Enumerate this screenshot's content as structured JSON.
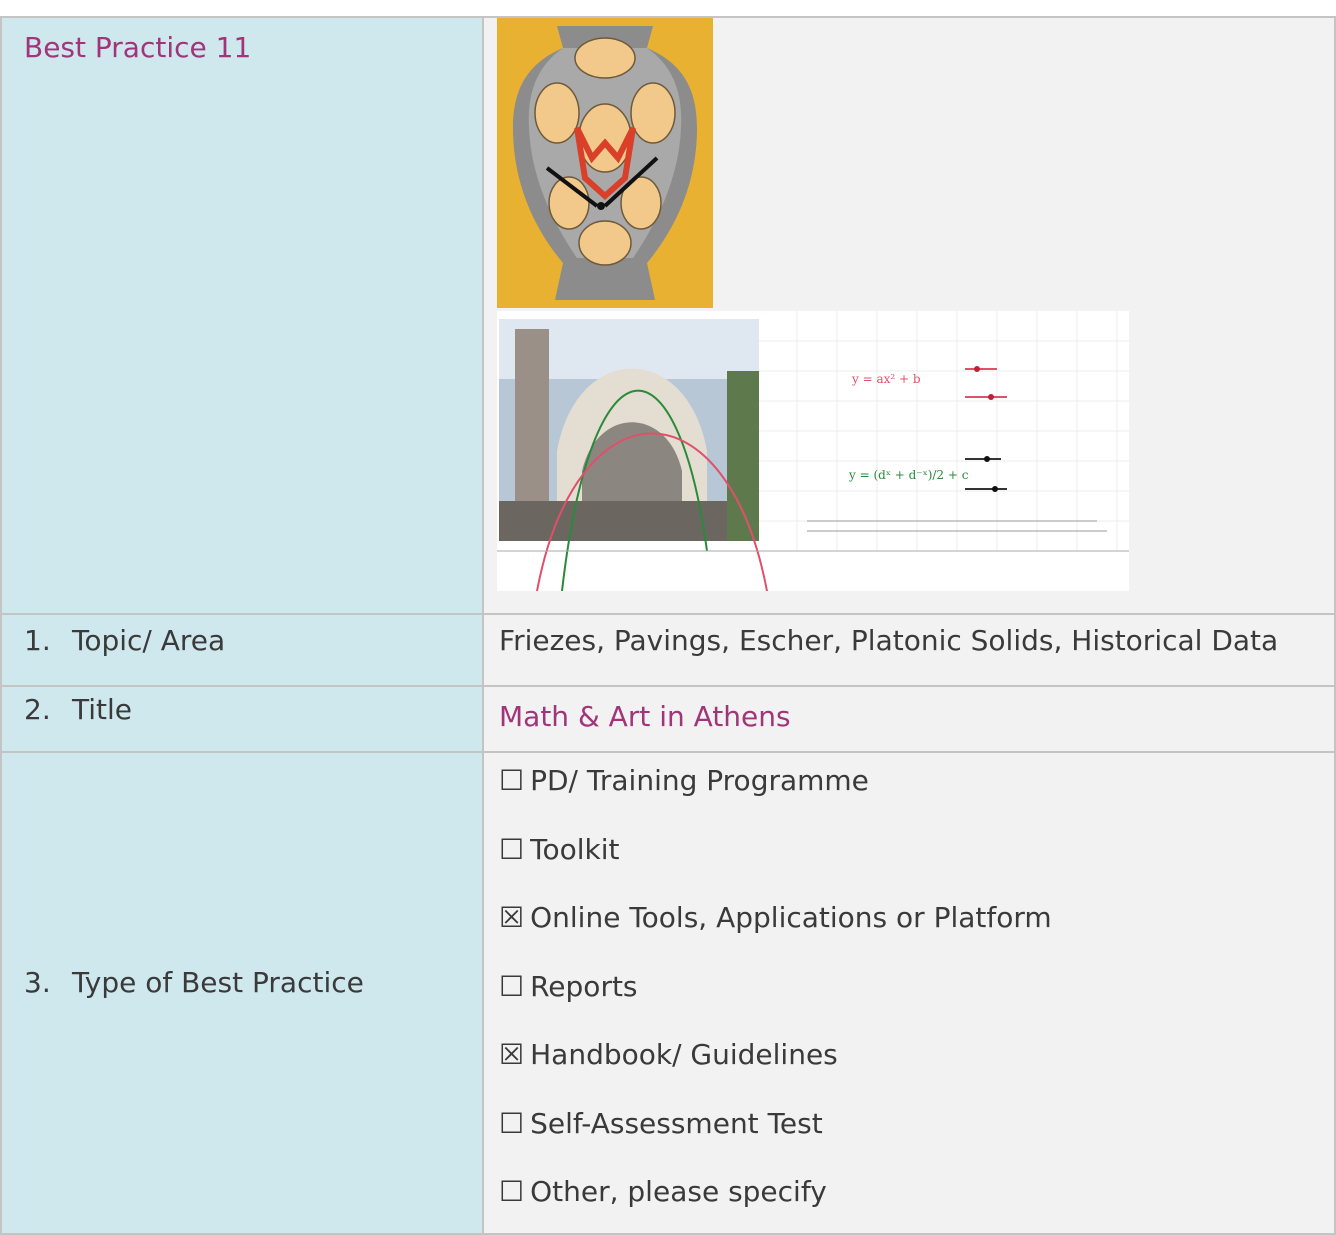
{
  "header": {
    "title": "Best Practice 11"
  },
  "rows": [
    {
      "num": "1.",
      "label": "Topic/ Area",
      "value": "Friezes, Pavings, Escher, Platonic Solids, Historical Data"
    },
    {
      "num": "2.",
      "label": "Title",
      "value": "Math & Art in Athens"
    },
    {
      "num": "3.",
      "label": "Type of Best Practice"
    }
  ],
  "type_options": [
    {
      "box": "☐",
      "label": "PD/ Training Programme",
      "checked": false
    },
    {
      "box": "☐",
      "label": "Toolkit",
      "checked": false
    },
    {
      "box": "☒",
      "label": "Online Tools, Applications or Platform",
      "checked": true
    },
    {
      "box": "☐",
      "label": "Reports",
      "checked": false
    },
    {
      "box": "☒",
      "label": "Handbook/ Guidelines",
      "checked": true
    },
    {
      "box": "☐",
      "label": "Self-Assessment Test",
      "checked": false
    },
    {
      "box": "☐",
      "label": "Other, please specify",
      "checked": false
    }
  ],
  "images": {
    "escher_vase_icon": "escher-amphora-tessellation",
    "parabola_icon": "church-arch-parabola-graph"
  },
  "colors": {
    "label_bg": "#cfe8ee",
    "value_bg": "#f2f2f2",
    "accent": "#a0357a",
    "border": "#c4c4c4"
  }
}
